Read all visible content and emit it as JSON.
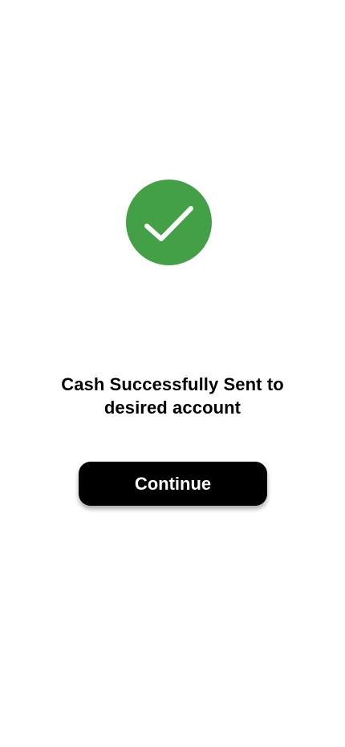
{
  "success": {
    "icon": "checkmark-circle-icon",
    "icon_color": "#43A047",
    "check_color": "#FFFFFF",
    "message": "Cash Successfully Sent to desired account"
  },
  "actions": {
    "continue_label": "Continue",
    "continue_bg": "#000000",
    "continue_text_color": "#FFFFFF"
  }
}
